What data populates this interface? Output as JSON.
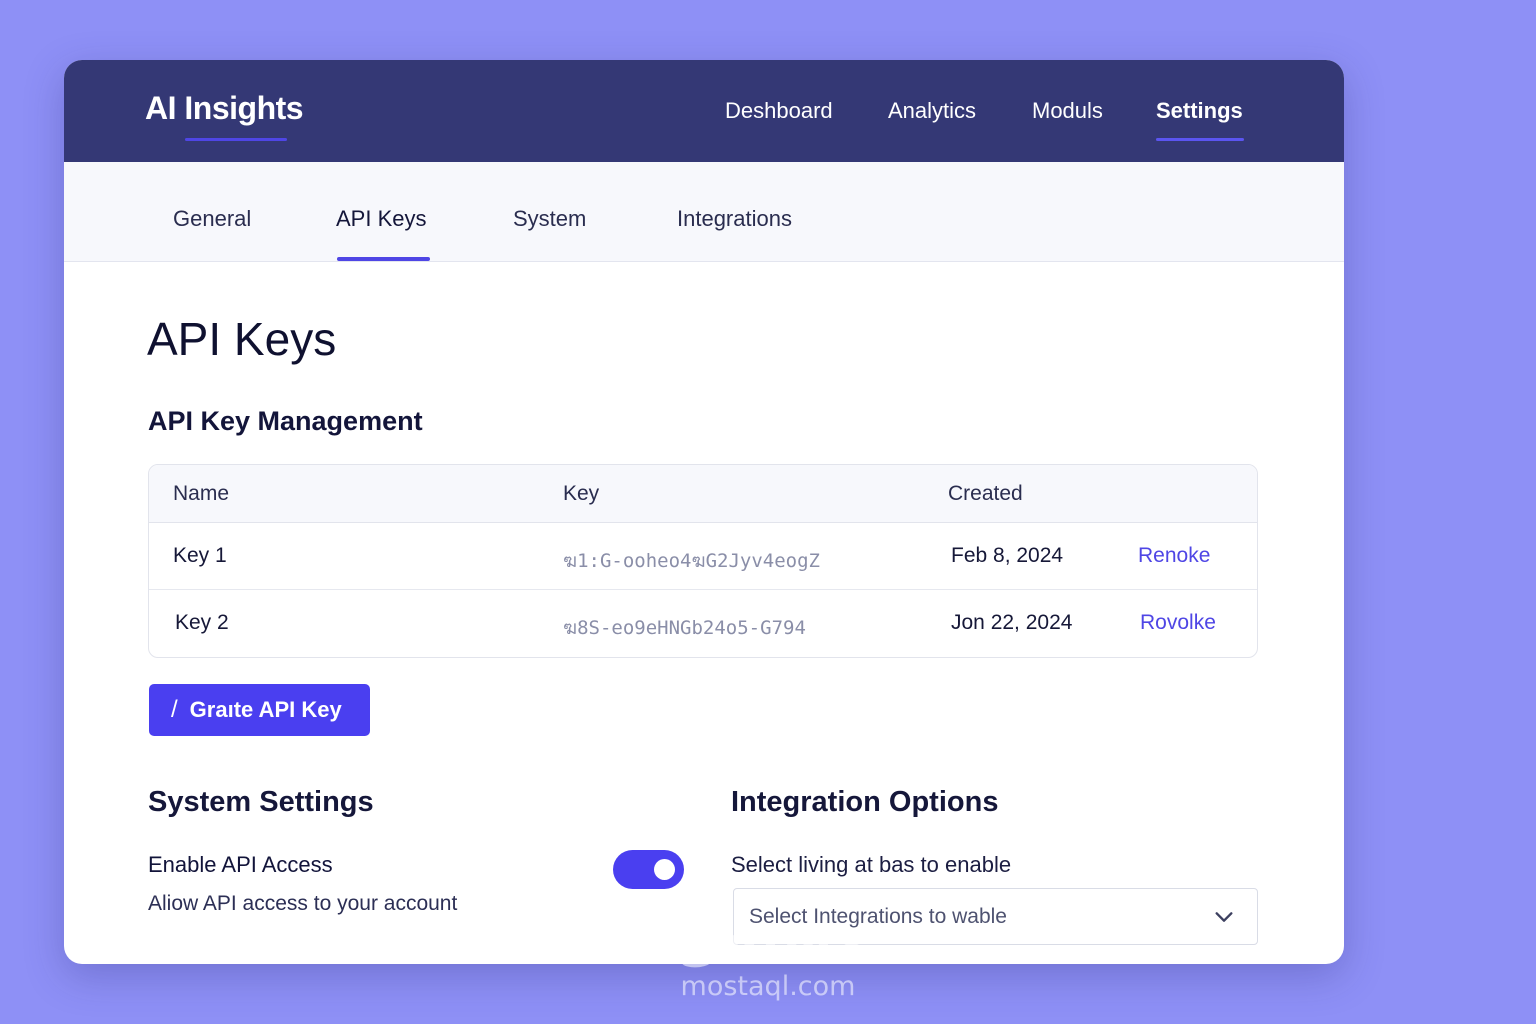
{
  "app": {
    "title": "AI Insights"
  },
  "nav": {
    "items": [
      {
        "label": "Deshboard"
      },
      {
        "label": "Analytics"
      },
      {
        "label": "Moduls"
      },
      {
        "label": "Settings",
        "active": true
      }
    ]
  },
  "subnav": {
    "tabs": [
      {
        "label": "General"
      },
      {
        "label": "API Keys",
        "active": true
      },
      {
        "label": "System"
      },
      {
        "label": "Integrations"
      }
    ]
  },
  "page": {
    "title": "API Keys",
    "section_title": "API Key Management"
  },
  "table": {
    "headers": [
      "Name",
      "Key",
      "Created"
    ],
    "rows": [
      {
        "name": "Key 1",
        "key": "ฆ1:G-oohеo4ฆG2Jyv4еogZ",
        "created": "Feb 8, 2024",
        "action": "Renoke"
      },
      {
        "name": "Key 2",
        "key": "ฆ8S-eo9eHNGb24o5-G794",
        "created": "Jon 22, 2024",
        "action": "Rovolke"
      }
    ]
  },
  "create_button": {
    "icon": "/",
    "label": "Graıte API Key"
  },
  "system_settings": {
    "title": "System Settings",
    "toggle_label": "Enable API Access",
    "toggle_description": "Aliow API access to your account",
    "toggle_on": true
  },
  "integration_options": {
    "title_bold": "Integration",
    "title_rest": " Options",
    "select_label": "Select living at bas to enable",
    "select_placeholder": "Select Integrations to wable"
  },
  "watermark": {
    "arabic": "مستقل",
    "latin": "mostaql.com"
  },
  "colors": {
    "background": "#8e90f6",
    "topbar": "#343875",
    "accent": "#4a3ff0",
    "link": "#4f46e5"
  }
}
